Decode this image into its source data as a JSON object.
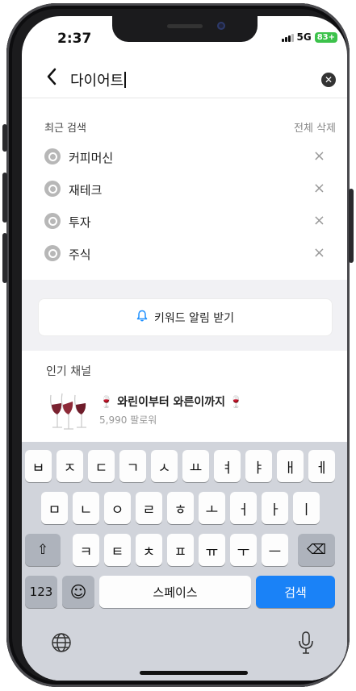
{
  "status": {
    "time": "2:37",
    "network": "5G",
    "battery": "83+"
  },
  "search": {
    "query": "다이어트",
    "back_icon": "chevron-left-icon",
    "clear_icon": "clear-circle-icon"
  },
  "recent": {
    "heading": "최근 검색",
    "delete_all": "전체 삭제",
    "items": [
      {
        "label": "커피머신"
      },
      {
        "label": "재테크"
      },
      {
        "label": "투자"
      },
      {
        "label": "주식"
      }
    ],
    "remove_symbol": "×"
  },
  "keyword_alert": {
    "label": "키워드 알림 받기",
    "icon": "bell-icon"
  },
  "popular": {
    "heading": "인기 채널",
    "channel": {
      "title": "🍷 와린이부터 와른이까지 🍷",
      "followers": "5,990 팔로워",
      "image": "wine-glasses-thumbnail"
    }
  },
  "keyboard": {
    "row1": [
      "ㅂ",
      "ㅈ",
      "ㄷ",
      "ㄱ",
      "ㅅ",
      "ㅛ",
      "ㅕ",
      "ㅑ",
      "ㅐ",
      "ㅔ"
    ],
    "row2": [
      "ㅁ",
      "ㄴ",
      "ㅇ",
      "ㄹ",
      "ㅎ",
      "ㅗ",
      "ㅓ",
      "ㅏ",
      "ㅣ"
    ],
    "row3": [
      "ㅋ",
      "ㅌ",
      "ㅊ",
      "ㅍ",
      "ㅠ",
      "ㅜ",
      "ㅡ"
    ],
    "shift": "⇧",
    "backspace": "⌫",
    "numbers": "123",
    "emoji": "☺",
    "space": "스페이스",
    "search": "검색",
    "globe": "🌐",
    "mic": "🎙"
  },
  "colors": {
    "accent": "#1a82f7",
    "keyboard_bg": "#d1d4db"
  }
}
